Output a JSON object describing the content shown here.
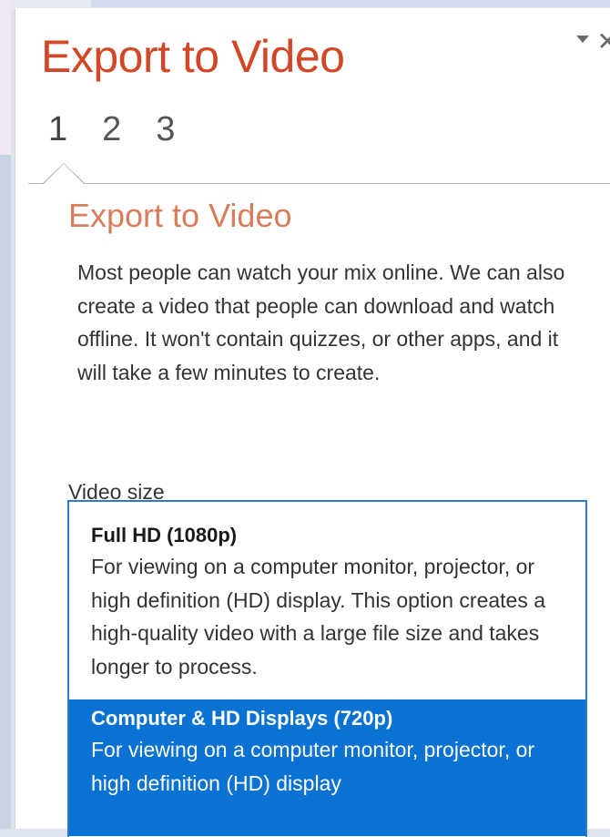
{
  "pane": {
    "title": "Export to Video"
  },
  "steps": [
    "1",
    "2",
    "3"
  ],
  "section": {
    "title": "Export to Video",
    "description": "Most people can watch your mix online. We can also create a video that people can download and watch offline. It won't contain quizzes, or other apps, and it will take a few minutes to create."
  },
  "video_size": {
    "label": "Video size",
    "options": [
      {
        "title": "Full HD (1080p)",
        "description": "For viewing on a computer monitor, projector, or high definition (HD) display. This option creates a high-quality video with a large file size and takes longer to process.",
        "selected": false
      },
      {
        "title": "Computer & HD Displays (720p)",
        "description": "For viewing on a computer monitor, projector, or high definition (HD) display",
        "selected": true
      }
    ]
  },
  "colors": {
    "title_accent": "#d24726",
    "section_accent": "#d87d5c",
    "selection_bg": "#0a72d2",
    "list_border": "#2b79d0"
  }
}
